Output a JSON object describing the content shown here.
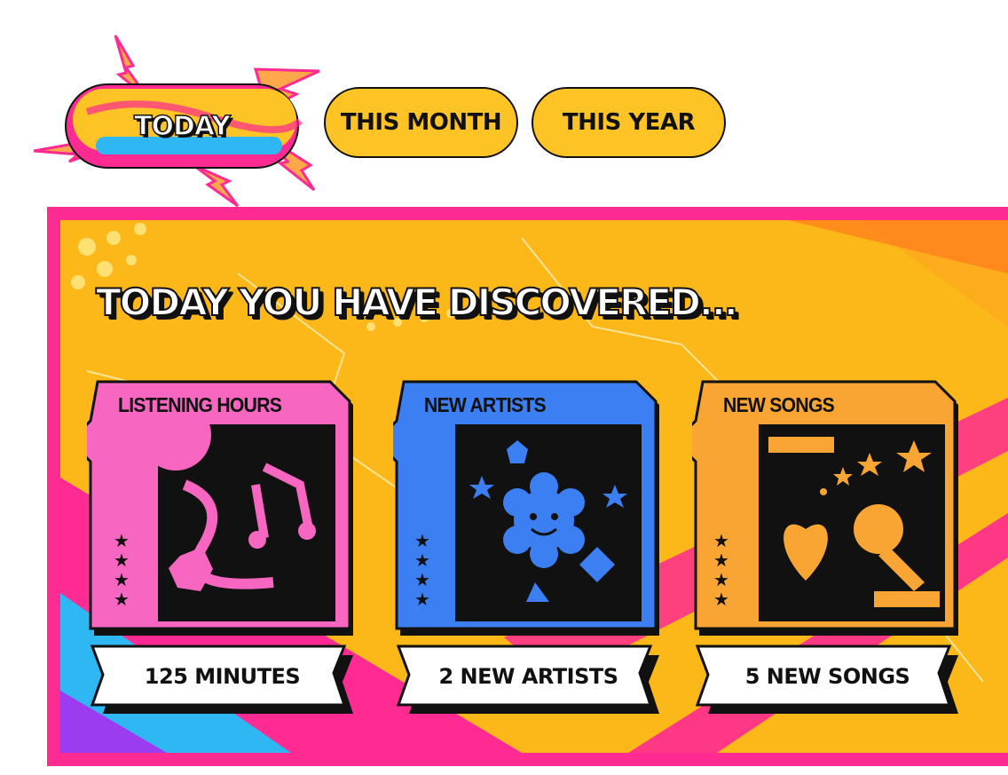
{
  "tabs": {
    "today": "TODAY",
    "month": "THIS MONTH",
    "year": "THIS YEAR",
    "active": "today"
  },
  "panel": {
    "headline": "TODAY YOU HAVE DISCOVERED..."
  },
  "cards": [
    {
      "title": "LISTENING HOURS",
      "value": "125 MINUTES",
      "color": "#f766c1",
      "icon": "music-notes-illustration"
    },
    {
      "title": "NEW ARTISTS",
      "value": "2 NEW ARTISTS",
      "color": "#3b7ff2",
      "icon": "flower-face-illustration"
    },
    {
      "title": "NEW SONGS",
      "value": "5 NEW SONGS",
      "color": "#f8a533",
      "icon": "heart-microphone-illustration"
    }
  ],
  "colors": {
    "tab_yellow": "#fec425",
    "panel_pink": "#ff2a92",
    "panel_orange": "#fcb818",
    "card_pink": "#f766c1",
    "card_blue": "#3b7ff2",
    "card_orange": "#f8a533"
  }
}
